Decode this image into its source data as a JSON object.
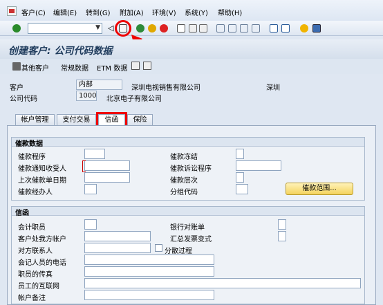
{
  "menubar": {
    "items": [
      "客户(C)",
      "编辑(E)",
      "转到(G)",
      "附加(A)",
      "环境(V)",
      "系统(Y)",
      "帮助(H)"
    ]
  },
  "toolbar": {
    "command_value": "",
    "icons": [
      "enter-icon",
      "back-icon",
      "save-icon",
      "exit-icon",
      "cancel-icon",
      "print-icon",
      "find-icon",
      "find-next-icon",
      "first-page-icon",
      "prev-page-icon",
      "next-page-icon",
      "last-page-icon",
      "new-session-icon",
      "shortcut-icon",
      "help-icon",
      "customize-icon"
    ]
  },
  "title": "创建客户: 公司代码数据",
  "app_toolbar": {
    "other_customer": "其他客户",
    "general_data": "常规数据",
    "etm_data": "ETM 数据"
  },
  "header": {
    "customer_label": "客户",
    "customer_value": "内部",
    "customer_name": "深圳电视销售有限公司",
    "city": "深圳",
    "company_code_label": "公司代码",
    "company_code_value": "1000",
    "company_name": "北京电子有限公司"
  },
  "tabs": [
    {
      "label": "帐户管理",
      "active": false
    },
    {
      "label": "支付交易",
      "active": false
    },
    {
      "label": "信函",
      "active": true
    },
    {
      "label": "保险",
      "active": false
    }
  ],
  "dunning": {
    "title": "催款数据",
    "procedure": "催款程序",
    "recipient": "催款通知收受人",
    "last_date": "上次催款单日期",
    "clerk": "催款经办人",
    "block": "催款冻结",
    "legal_date": "催款诉讼程序",
    "level": "催款层次",
    "group_key": "分组代码",
    "range_button": "催款范围..."
  },
  "correspondence": {
    "title": "信函",
    "acct_clerk": "会计职员",
    "acct_at_customer": "客户处我方帐户",
    "contact": "对方联系人",
    "clerk_phone": "会记人员的电话",
    "clerk_fax": "职员的传真",
    "clerk_internet": "员工的互联网",
    "acct_memo": "帐户备注",
    "bank_statement": "银行对账单",
    "collective_invoice": "汇总发票变式",
    "decentralized": "分散过程"
  }
}
